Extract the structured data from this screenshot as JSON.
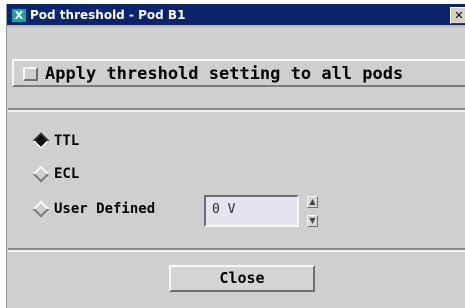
{
  "window": {
    "icon_glyph": "X",
    "title": "Pod threshold - Pod B1",
    "close_glyph": "✕"
  },
  "apply_all": {
    "label": "Apply threshold setting to all pods",
    "checked": false
  },
  "threshold": {
    "options": [
      {
        "label": "TTL",
        "selected": true
      },
      {
        "label": "ECL",
        "selected": false
      },
      {
        "label": "User Defined",
        "selected": false
      }
    ],
    "user_value": "0 V",
    "spin_up_glyph": "▲",
    "spin_down_glyph": "▼"
  },
  "footer": {
    "close_label": "Close"
  }
}
